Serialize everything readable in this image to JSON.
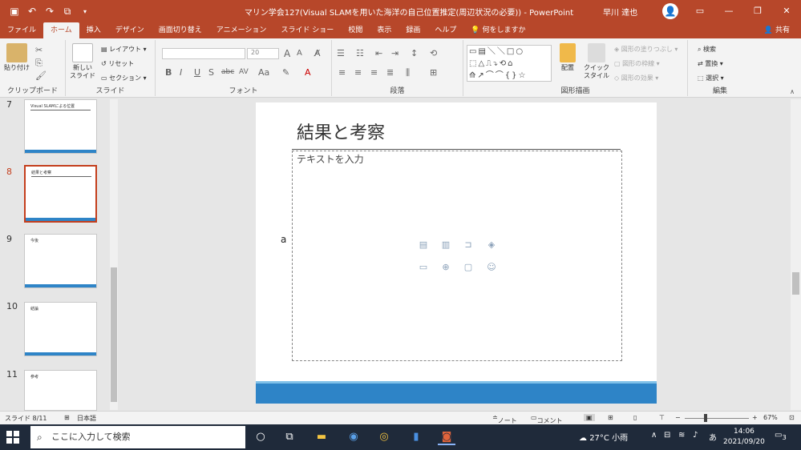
{
  "titlebar": {
    "document_title": "マリン学会127(Visual SLAMを用いた海洋の自己位置推定(周辺状況の必要)) - PowerPoint",
    "user_name": "早川 達也",
    "avatar_glyph": "👤",
    "quick_access": [
      "save-icon",
      "undo-icon",
      "redo-icon",
      "slideshow-icon",
      "customize-icon"
    ]
  },
  "tabs": [
    {
      "label": "ファイル",
      "active": false
    },
    {
      "label": "ホーム",
      "active": true
    },
    {
      "label": "挿入",
      "active": false
    },
    {
      "label": "デザイン",
      "active": false
    },
    {
      "label": "画面切り替え",
      "active": false
    },
    {
      "label": "アニメーション",
      "active": false
    },
    {
      "label": "スライド ショー",
      "active": false
    },
    {
      "label": "校閲",
      "active": false
    },
    {
      "label": "表示",
      "active": false
    },
    {
      "label": "録画",
      "active": false
    },
    {
      "label": "ヘルプ",
      "active": false
    },
    {
      "label": "何をしますか",
      "active": false
    }
  ],
  "share_label": "共有",
  "ribbon": {
    "clipboard": {
      "group_label": "クリップボード",
      "paste_label": "貼り付け"
    },
    "slides": {
      "group_label": "スライド",
      "new_slide_label": "新しい スライド",
      "layout_label": "レイアウト",
      "reset_label": "リセット",
      "section_label": "セクション"
    },
    "font": {
      "group_label": "フォント",
      "font_name": "",
      "font_size": "20",
      "bold": "B",
      "italic": "I",
      "underline": "U",
      "shadow": "S",
      "strike": "abc",
      "spacing": "AV",
      "case": "Aa",
      "grow": "A",
      "shrink": "A"
    },
    "paragraph": {
      "group_label": "段落"
    },
    "drawing": {
      "group_label": "図形描画",
      "arrange_label": "配置",
      "quick_style_label": "クイック スタイル",
      "fill_label": "図形の塗りつぶし",
      "outline_label": "図形の枠線",
      "effect_label": "図形の効果"
    },
    "editing": {
      "group_label": "編集",
      "find_label": "検索",
      "replace_label": "置換",
      "select_label": "選択"
    }
  },
  "thumbnails": [
    {
      "number": "7",
      "title": "Visual SLAMによる位置",
      "selected": false
    },
    {
      "number": "8",
      "title": "結果と考察",
      "selected": true
    },
    {
      "number": "9",
      "title": "今後",
      "selected": false
    },
    {
      "number": "10",
      "title": "結論",
      "selected": false
    },
    {
      "number": "11",
      "title": "参考",
      "selected": false
    }
  ],
  "slide": {
    "title": "結果と考察",
    "content_placeholder": "テキストを入力",
    "side_text": "a",
    "placeholder_icons": [
      "insert-table-icon",
      "insert-chart-icon",
      "insert-smartart-icon",
      "insert-3d-model-icon",
      "insert-picture-icon",
      "insert-online-picture-icon",
      "insert-video-icon",
      "insert-icons-icon"
    ]
  },
  "status": {
    "slide_info": "スライド 8/11",
    "language": "日本語",
    "notes_label": "ノート",
    "comments_label": "コメント",
    "zoom": "67%",
    "zoom_minus": "−",
    "zoom_plus": "+"
  },
  "taskbar": {
    "search_placeholder": "ここに入力して検索",
    "weather": "27°C 小雨",
    "ime": "あ",
    "time": "14:06",
    "date": "2021/09/20",
    "notification_count": "3"
  }
}
